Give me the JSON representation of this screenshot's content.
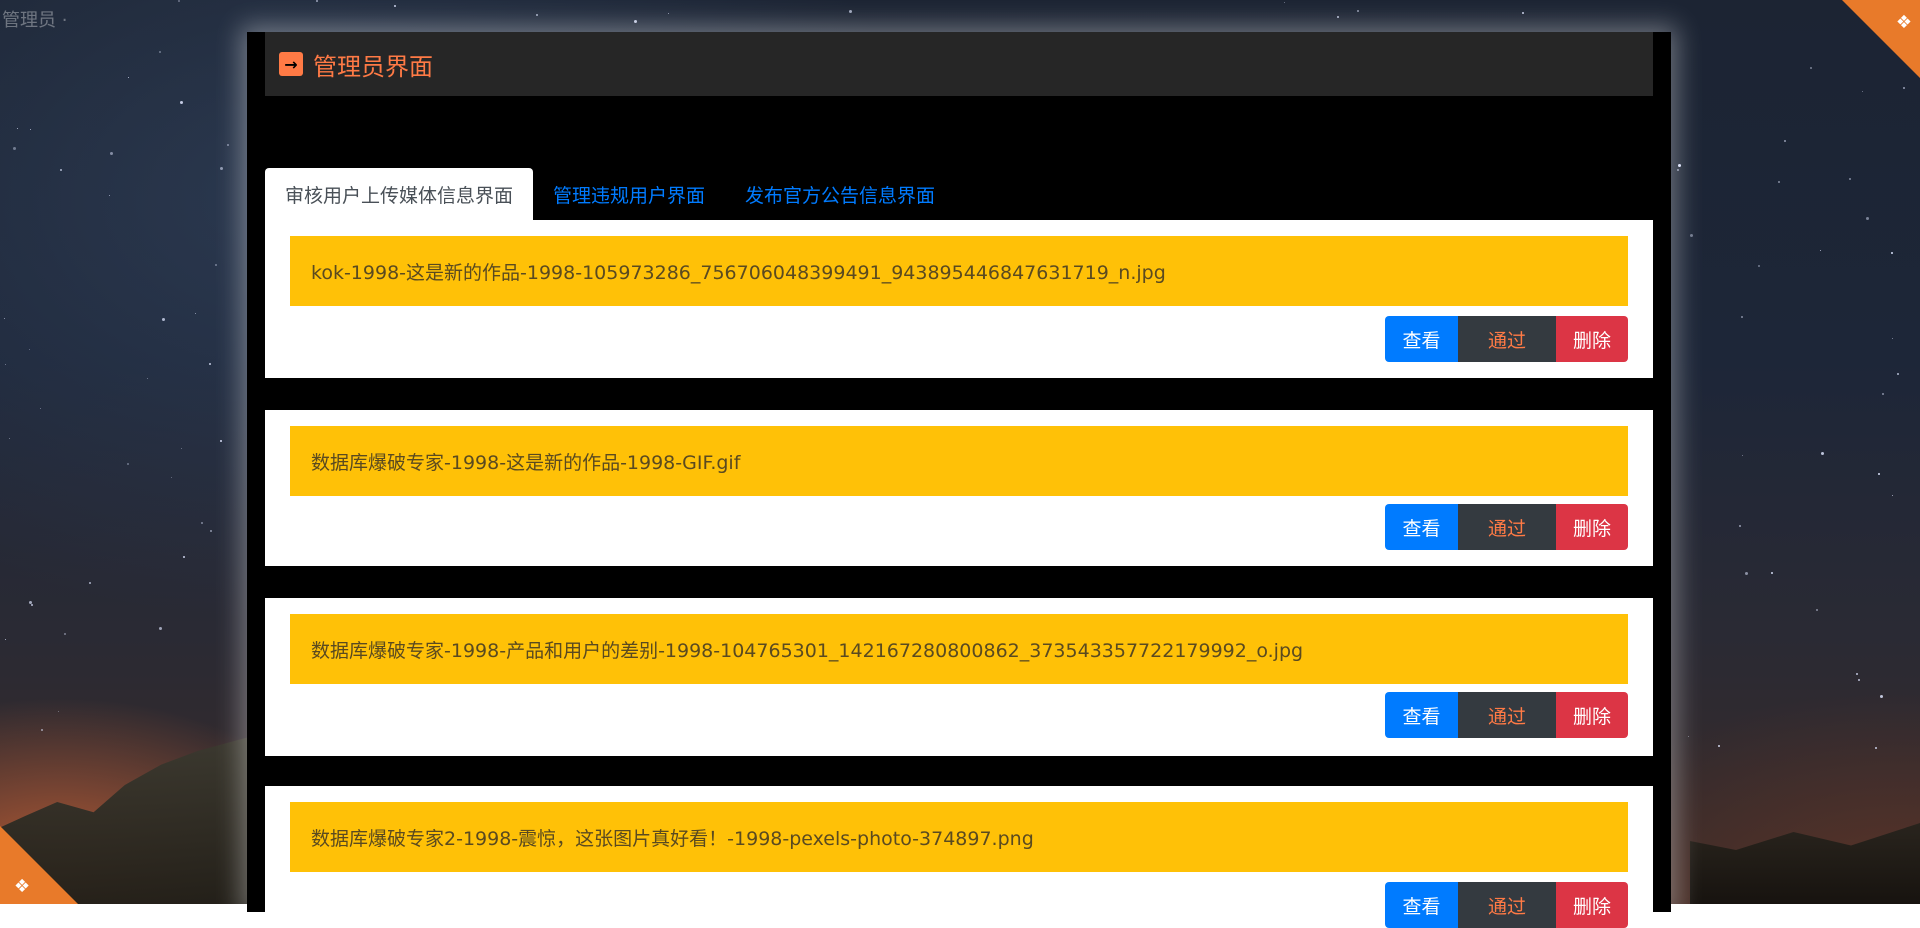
{
  "page": {
    "corner_text": "管理员 ·",
    "corner_icon": "grid-icon"
  },
  "header": {
    "icon": "arrow-right-icon",
    "title": "管理员界面"
  },
  "tabs": [
    {
      "label": "审核用户上传媒体信息界面",
      "active": true
    },
    {
      "label": "管理违规用户界面",
      "active": false
    },
    {
      "label": "发布官方公告信息界面",
      "active": false
    }
  ],
  "items": [
    {
      "title": "kok-1998-这是新的作品-1998-105973286_756706048399491_943895446847631719_n.jpg"
    },
    {
      "title": "数据库爆破专家-1998-这是新的作品-1998-GIF.gif"
    },
    {
      "title": "数据库爆破专家-1998-产品和用户的差别-1998-104765301_142167280800862_373543357722179992_o.jpg"
    },
    {
      "title": "数据库爆破专家2-1998-震惊，这张图片真好看！-1998-pexels-photo-374897.png"
    }
  ],
  "buttons": {
    "view": "查看",
    "pass": "通过",
    "delete": "删除"
  },
  "colors": {
    "accent": "#ff7a45",
    "title_bg": "#ffc107",
    "view_btn": "#007bff",
    "pass_btn": "#343a40",
    "delete_btn": "#dc3545"
  }
}
